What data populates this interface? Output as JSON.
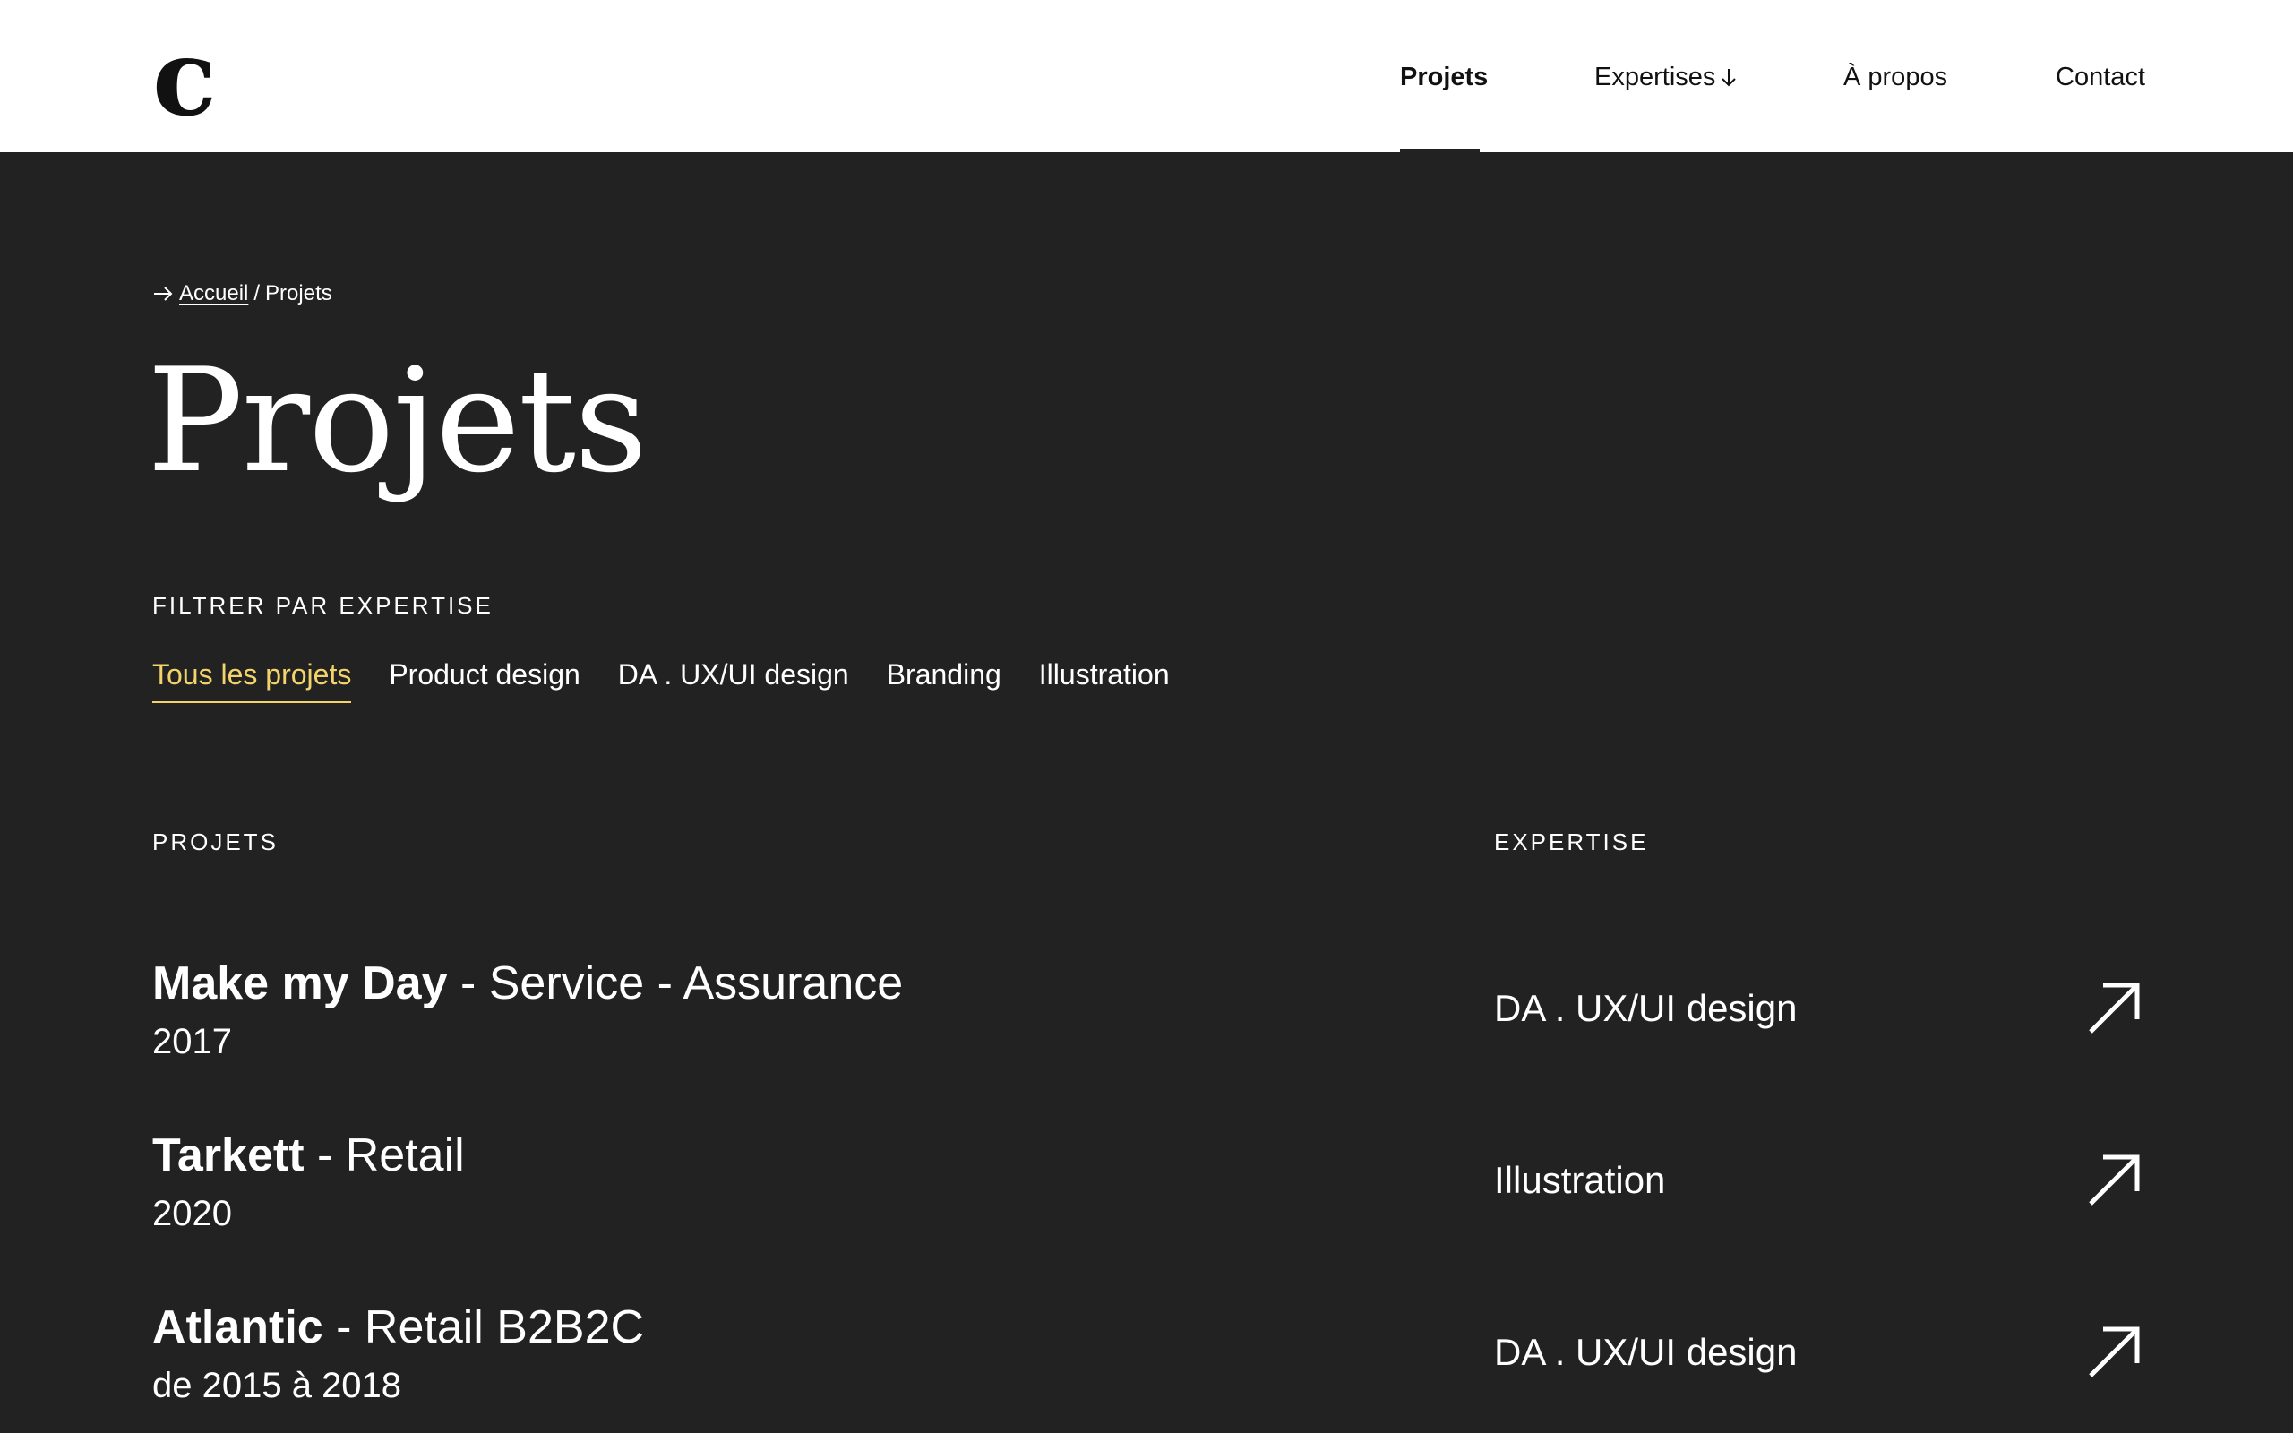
{
  "header": {
    "logo": "c",
    "nav": [
      {
        "label": "Projets"
      },
      {
        "label": "Expertises"
      },
      {
        "label": "À propos"
      },
      {
        "label": "Contact"
      }
    ]
  },
  "breadcrumb": {
    "home": "Accueil",
    "separator": "/",
    "current": "Projets"
  },
  "page_title": "Projets",
  "filter": {
    "label": "FILTRER PAR EXPERTISE",
    "tabs": [
      {
        "label": "Tous les projets"
      },
      {
        "label": "Product design"
      },
      {
        "label": "DA . UX/UI design"
      },
      {
        "label": "Branding"
      },
      {
        "label": "Illustration"
      }
    ]
  },
  "columns": {
    "projects": "PROJETS",
    "expertise": "EXPERTISE"
  },
  "projects": [
    {
      "name": "Make my Day",
      "detail": " - Service - Assurance",
      "year": "2017",
      "expertise": "DA . UX/UI design"
    },
    {
      "name": "Tarkett",
      "detail": " - Retail",
      "year": "2020",
      "expertise": "Illustration"
    },
    {
      "name": "Atlantic",
      "detail": " - Retail B2B2C",
      "year": "de 2015 à 2018",
      "expertise": "DA . UX/UI design"
    }
  ],
  "colors": {
    "background": "#222222",
    "header_bg": "#ffffff",
    "accent": "#f2d46b"
  }
}
